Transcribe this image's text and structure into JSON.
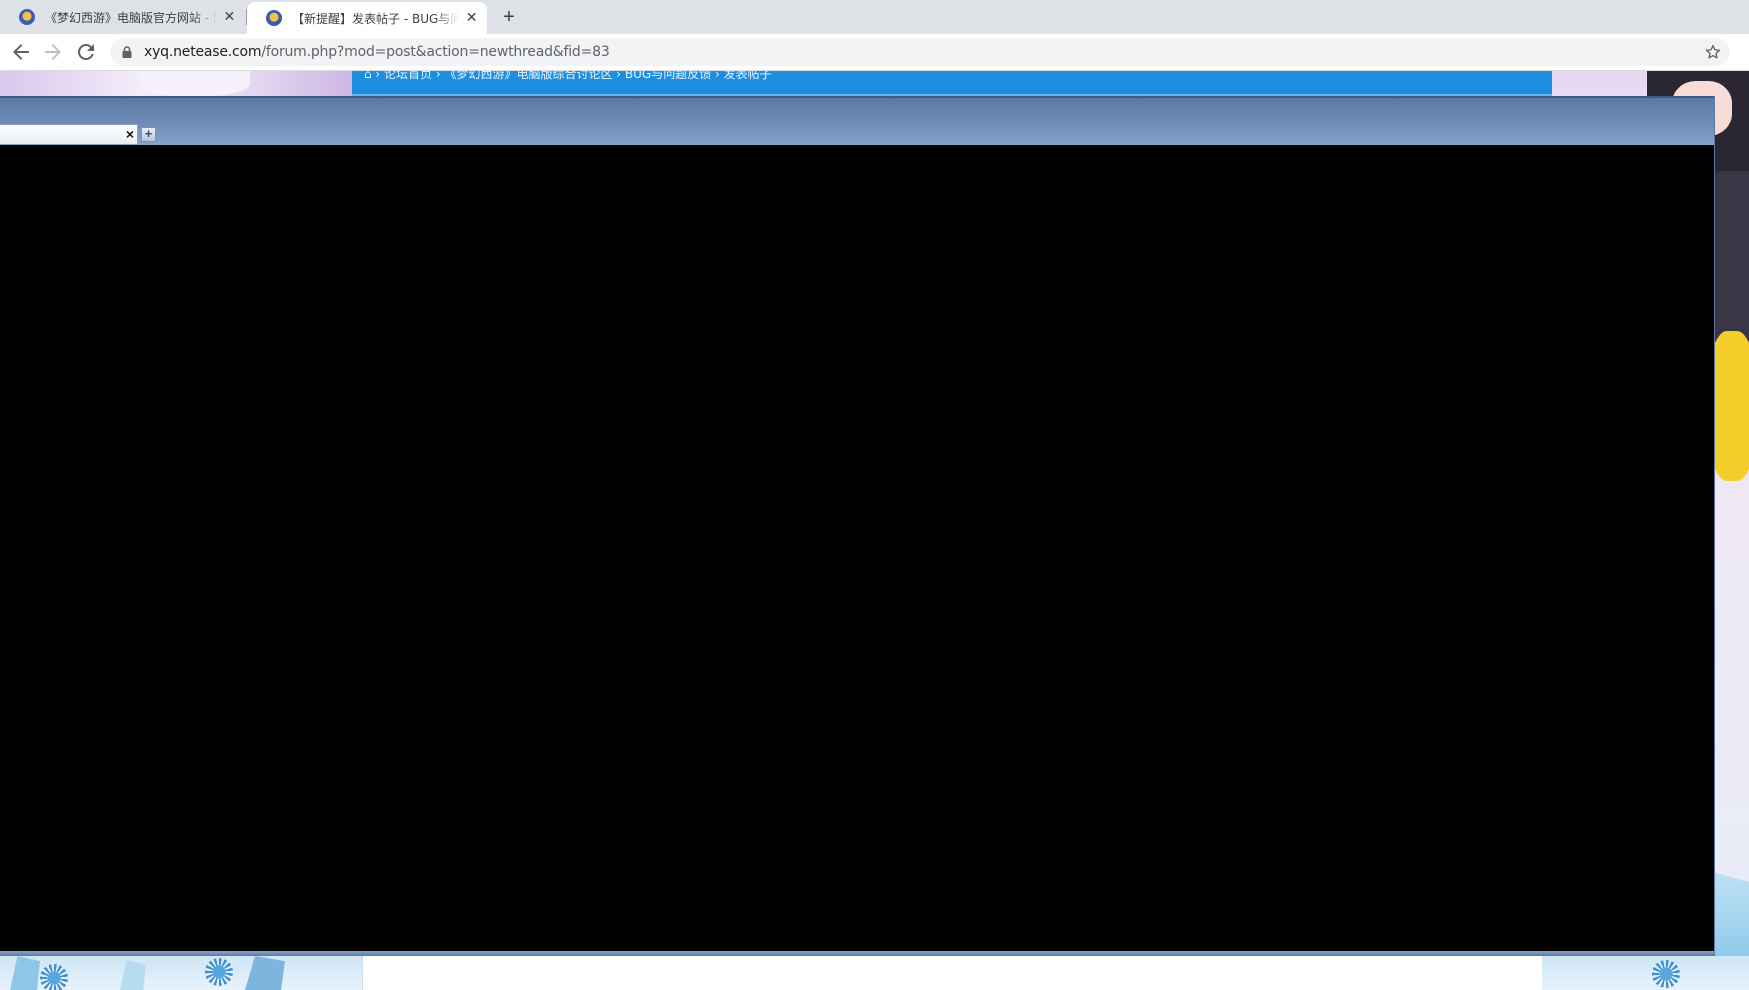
{
  "browser": {
    "tabs": [
      {
        "title": "《梦幻西游》电脑版官方网站 - 网",
        "active": false,
        "favicon": "game-logo-icon"
      },
      {
        "title": "【新提醒】发表帖子 - BUG与问题",
        "active": true,
        "favicon": "game-logo-icon"
      }
    ],
    "new_tab_icon": "plus-icon",
    "address": {
      "host": "xyq.netease.com",
      "path": "/forum.php?mod=post&action=newthread&fid=83"
    },
    "icons": {
      "back": "back-arrow-icon",
      "forward": "forward-arrow-icon",
      "reload": "reload-icon",
      "lock": "lock-icon",
      "bookmark": "star-icon"
    }
  },
  "page": {
    "breadcrumb": "⌂ › 论坛首页 › 《梦幻西游》电脑版综合讨论区 › BUG与问题反馈 › 发表帖子",
    "overlay": {
      "tab_close_symbol": "×",
      "add_tab_symbol": "+"
    }
  },
  "colors": {
    "forum_bar": "#1e8fe0",
    "overlay_header": "#6f8db7",
    "overlay_body": "#000000"
  }
}
